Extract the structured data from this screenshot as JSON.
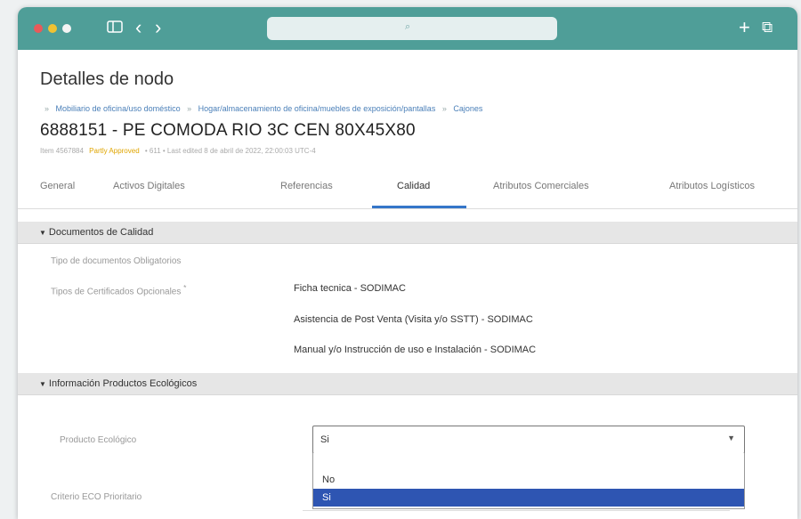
{
  "colors": {
    "titlebar": "#4f9e98",
    "accent": "#3576c9",
    "status_pending": "#e0a500",
    "selected_option": "#2e55b2",
    "dot_red": "#e85a5a",
    "dot_yellow": "#f1c232",
    "dot_green": "#f4f4f4"
  },
  "browser": {
    "sidebar_icon": "sidebar-icon",
    "back_icon": "‹",
    "forward_icon": "›",
    "search_icon": "⌕",
    "new_tab_icon": "+",
    "tabs_icon": "⧉"
  },
  "page": {
    "title": "Detalles de nodo",
    "breadcrumb": [
      "Mobiliario de oficina/uso doméstico",
      "Hogar/almacenamiento de oficina/muebles de exposición/pantallas",
      "Cajones"
    ],
    "breadcrumb_sep": "»",
    "product_title": "6888151 - PE COMODA RIO 3C CEN 80X45X80",
    "meta": {
      "id": "Item 4567884",
      "status": "Partly Approved",
      "info": "• 611 • Last edited 8 de abril de 2022, 22:00:03 UTC-4"
    }
  },
  "tabs": [
    {
      "label": "General"
    },
    {
      "label": "Activos Digitales"
    },
    {
      "label": "Referencias"
    },
    {
      "label": "Calidad"
    },
    {
      "label": "Atributos Comerciales"
    },
    {
      "label": "Atributos Logísticos"
    }
  ],
  "sections": {
    "quality": {
      "title": "Documentos de Calidad",
      "mandatory_label": "Tipo de documentos Obligatorios",
      "optional_label": "Tipos de Certificados Opcionales",
      "required_marker": "*",
      "optional_values": [
        "Ficha tecnica - SODIMAC",
        "Asistencia de Post Venta (Visita y/o SSTT) - SODIMAC",
        "Manual y/o Instrucción de uso e Instalación - SODIMAC"
      ]
    },
    "eco": {
      "title": "Información Productos Ecológicos",
      "eco_product_label": "Producto Ecológico",
      "eco_product_value": "Si",
      "options": [
        "No",
        "Si"
      ],
      "selected_option": "Si",
      "criteria_label": "Criterio ECO Prioritario"
    }
  }
}
